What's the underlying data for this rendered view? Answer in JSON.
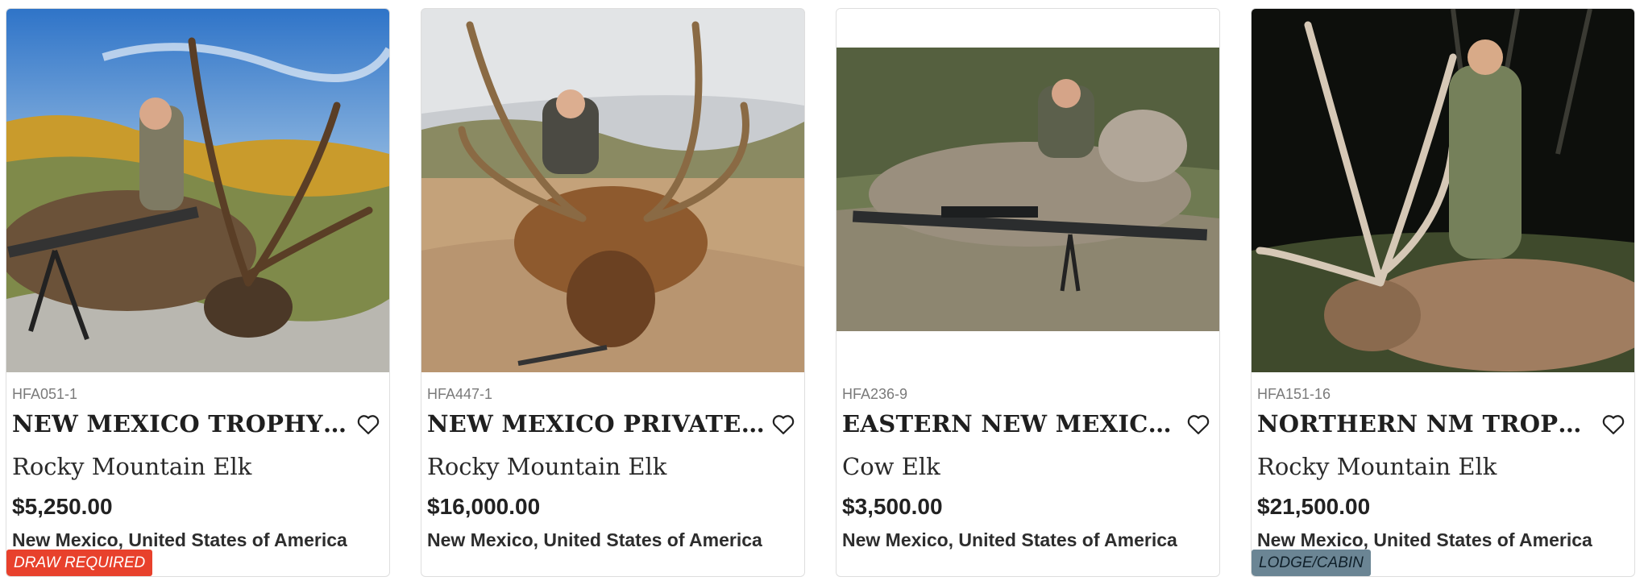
{
  "listings": [
    {
      "sku": "HFA051-1",
      "title": "NEW MEXICO TROPHY ELK ...",
      "species": "Rocky Mountain Elk",
      "price": "$5,250.00",
      "location": "New Mexico, United States of America",
      "badge": "DRAW REQUIRED",
      "badge_color": "#e8412c"
    },
    {
      "sku": "HFA447-1",
      "title": "NEW MEXICO PRIVATE ELK ...",
      "species": "Rocky Mountain Elk",
      "price": "$16,000.00",
      "location": "New Mexico, United States of America",
      "badge": ""
    },
    {
      "sku": "HFA236-9",
      "title": "EASTERN NEW MEXICO CO...",
      "species": "Cow Elk",
      "price": "$3,500.00",
      "location": "New Mexico, United States of America",
      "badge": ""
    },
    {
      "sku": "HFA151-16",
      "title": "NORTHERN NM TROPHY EL...",
      "species": "Rocky Mountain Elk",
      "price": "$21,500.00",
      "location": "New Mexico, United States of America",
      "badge": "LODGE/CABIN",
      "badge_color": "#6b8594"
    }
  ],
  "icons": {
    "favorite": "heart-outline-icon"
  }
}
